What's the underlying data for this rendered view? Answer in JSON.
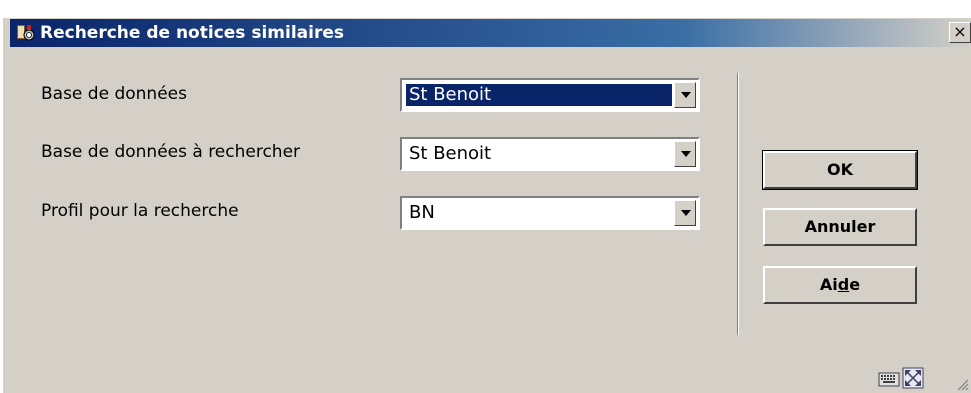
{
  "window": {
    "title": "Recherche de notices similaires",
    "close_label": "×"
  },
  "form": {
    "fields": [
      {
        "label": "Base de données",
        "value": "St Benoit"
      },
      {
        "label": "Base de données à rechercher",
        "value": "St Benoit"
      },
      {
        "label": "Profil pour la recherche",
        "value": "BN"
      }
    ]
  },
  "buttons": {
    "ok": "OK",
    "cancel": "Annuler",
    "help_pre": "Ai",
    "help_ul": "d",
    "help_post": "e"
  },
  "icons": {
    "title": "app-icon",
    "status": [
      "keyboard-icon",
      "expand-icon"
    ]
  },
  "colors": {
    "titlebar_start": "#0a246a",
    "titlebar_end": "#3a6ea5",
    "face": "#d4d0c8",
    "selection": "#0a246a"
  }
}
